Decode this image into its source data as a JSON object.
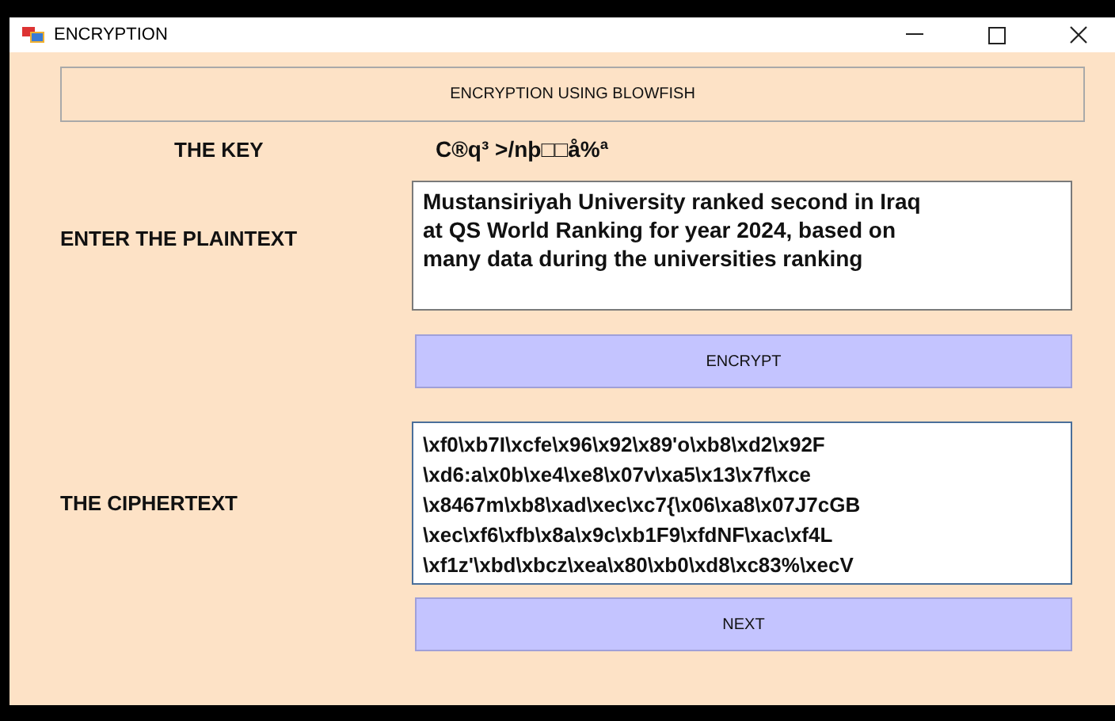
{
  "window": {
    "title": "ENCRYPTION"
  },
  "header": {
    "label": "ENCRYPTION USING BLOWFISH"
  },
  "key": {
    "label": "THE KEY",
    "value": "C®q³  >/nþ□□å%ª"
  },
  "plaintext": {
    "label": "ENTER THE PLAINTEXT",
    "value": "Mustansiriyah University ranked second in Iraq\nat QS World Ranking for year 2024, based on\nmany data during the universities ranking"
  },
  "encrypt_button": "ENCRYPT",
  "ciphertext": {
    "label": "THE CIPHERTEXT",
    "value": "\\xf0\\xb7I\\xcfe\\x96\\x92\\x89'o\\xb8\\xd2\\x92F\n\\xd6:a\\x0b\\xe4\\xe8\\x07v\\xa5\\x13\\x7f\\xce\n\\x8467m\\xb8\\xad\\xec\\xc7{\\x06\\xa8\\x07J7cGB\n\\xec\\xf6\\xfb\\x8a\\x9c\\xb1F9\\xfdNF\\xac\\xf4L\n\\xf1z'\\xbd\\xbcz\\xea\\x80\\xb0\\xd8\\xc83%\\xecV"
  },
  "next_button": "NEXT"
}
